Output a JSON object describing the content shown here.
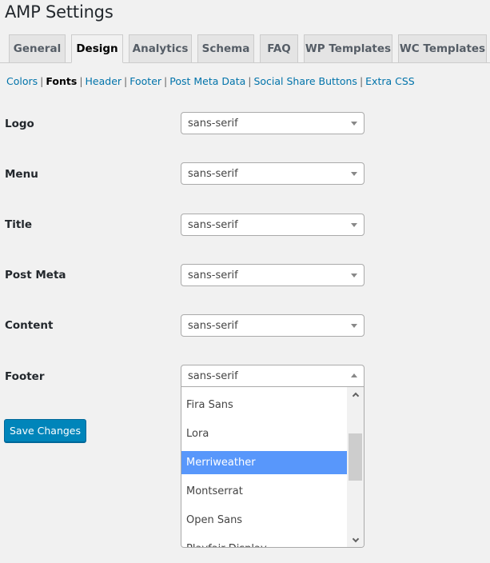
{
  "page": {
    "title": "AMP Settings"
  },
  "tabs": [
    {
      "label": "General",
      "active": false
    },
    {
      "label": "Design",
      "active": true
    },
    {
      "label": "Analytics",
      "active": false
    },
    {
      "label": "Schema",
      "active": false
    },
    {
      "label": "FAQ",
      "active": false
    },
    {
      "label": "WP Templates",
      "active": false
    },
    {
      "label": "WC Templates",
      "active": false
    }
  ],
  "subnav": {
    "separator": "|",
    "items": [
      {
        "label": "Colors",
        "current": false
      },
      {
        "label": "Fonts",
        "current": true
      },
      {
        "label": "Header",
        "current": false
      },
      {
        "label": "Footer",
        "current": false
      },
      {
        "label": "Post Meta Data",
        "current": false
      },
      {
        "label": "Social Share Buttons",
        "current": false
      },
      {
        "label": "Extra CSS",
        "current": false
      }
    ]
  },
  "fonts": [
    {
      "label": "Logo",
      "value": "sans-serif"
    },
    {
      "label": "Menu",
      "value": "sans-serif"
    },
    {
      "label": "Title",
      "value": "sans-serif"
    },
    {
      "label": "Post Meta",
      "value": "sans-serif"
    },
    {
      "label": "Content",
      "value": "sans-serif"
    },
    {
      "label": "Footer",
      "value": "sans-serif",
      "open": true
    }
  ],
  "dropdown": {
    "options": [
      "Fira Sans",
      "Lora",
      "Merriweather",
      "Montserrat",
      "Open Sans",
      "Playfair Display"
    ],
    "highlighted": "Merriweather"
  },
  "actions": {
    "save_label": "Save Changes"
  },
  "colors": {
    "accent": "#0085ba",
    "link": "#0073aa",
    "highlight": "#5897fb",
    "background": "#f1f1f1"
  }
}
